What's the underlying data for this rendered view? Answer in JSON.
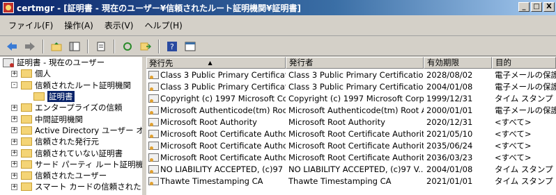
{
  "window": {
    "title": "certmgr - [証明書 - 現在のユーザー¥信頼されたルート証明機関¥証明書]",
    "controls": [
      "_",
      "□",
      "X"
    ]
  },
  "menu": [
    "ファイル(F)",
    "操作(A)",
    "表示(V)",
    "ヘルプ(H)"
  ],
  "toolbar": {
    "icons": [
      "back-arrow-icon",
      "forward-arrow-icon",
      "up-folder-icon",
      "show-hide-tree-icon",
      "properties-icon",
      "refresh-icon",
      "export-list-icon",
      "help-icon",
      "console-icon"
    ]
  },
  "tree": {
    "root": "証明書 - 現在のユーザー",
    "items": [
      {
        "label": "個人",
        "expander": "+"
      },
      {
        "label": "信頼されたルート証明機関",
        "expander": "-"
      },
      {
        "label": "証明書",
        "selected": true
      },
      {
        "label": "エンタープライズの信頼",
        "expander": "+"
      },
      {
        "label": "中間証明機関",
        "expander": "+"
      },
      {
        "label": "Active Directory ユーザー オブジ",
        "expander": "+"
      },
      {
        "label": "信頼された発行元",
        "expander": "+"
      },
      {
        "label": "信頼されていない証明書",
        "expander": "+"
      },
      {
        "label": "サード パーティ ルート証明機関",
        "expander": "+"
      },
      {
        "label": "信頼されたユーザー",
        "expander": "+"
      },
      {
        "label": "スマート カードの信頼されたルー|",
        "expander": "+"
      }
    ]
  },
  "list": {
    "headers": [
      "発行先",
      "発行者",
      "有効期限",
      "目的"
    ],
    "rows": [
      [
        "Class 3 Public Primary Certificat...",
        "Class 3 Public Primary Certificatio...",
        "2028/08/02",
        "電子メールの保護"
      ],
      [
        "Class 3 Public Primary Certificat...",
        "Class 3 Public Primary Certificatio...",
        "2004/01/08",
        "電子メールの保護"
      ],
      [
        "Copyright (c) 1997 Microsoft Cor...",
        "Copyright (c) 1997 Microsoft Corp.",
        "1999/12/31",
        "タイム スタンプ"
      ],
      [
        "Microsoft Authenticode(tm) Root...",
        "Microsoft Authenticode(tm) Root A...",
        "2000/01/01",
        "電子メールの保護"
      ],
      [
        "Microsoft Root Authority",
        "Microsoft Root Authority",
        "2020/12/31",
        "<すべて>"
      ],
      [
        "Microsoft Root Certificate Autho...",
        "Microsoft Root Certificate Authority",
        "2021/05/10",
        "<すべて>"
      ],
      [
        "Microsoft Root Certificate Autho...",
        "Microsoft Root Certificate Authorit...",
        "2035/06/24",
        "<すべて>"
      ],
      [
        "Microsoft Root Certificate Autho...",
        "Microsoft Root Certificate Authorit...",
        "2036/03/23",
        "<すべて>"
      ],
      [
        "NO LIABILITY ACCEPTED, (c)97 ...",
        "NO LIABILITY ACCEPTED, (c)97 V...",
        "2004/01/08",
        "タイム スタンプ"
      ],
      [
        "Thawte Timestamping CA",
        "Thawte Timestamping CA",
        "2021/01/01",
        "タイム スタンプ"
      ]
    ]
  }
}
